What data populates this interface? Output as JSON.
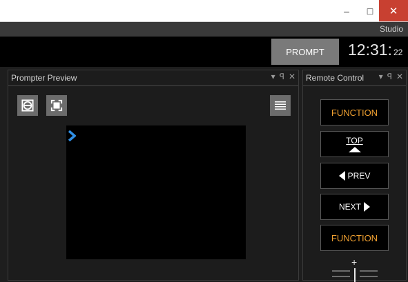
{
  "window": {
    "min_glyph": "–",
    "max_glyph": "□",
    "close_glyph": "✕",
    "close_color": "#c84031"
  },
  "header": {
    "workspace": "Studio",
    "prompt_button": "PROMPT",
    "clock_main": "12:31:",
    "clock_seconds": "22"
  },
  "preview_panel": {
    "title": "Prompter Preview",
    "dropdown_glyph": "▾",
    "pin_glyph": "ꟼ",
    "close_glyph": "✕",
    "tools": [
      "frame-icon",
      "fullscreen-icon",
      "menu-icon"
    ]
  },
  "remote_panel": {
    "title": "Remote Control",
    "dropdown_glyph": "▾",
    "pin_glyph": "ꟼ",
    "close_glyph": "✕",
    "buttons": {
      "function_top": "FUNCTION",
      "top": "TOP",
      "prev": "PREV",
      "next": "NEXT",
      "function_bottom": "FUNCTION"
    },
    "speed_plus": "+",
    "function_color": "#f0a030"
  }
}
